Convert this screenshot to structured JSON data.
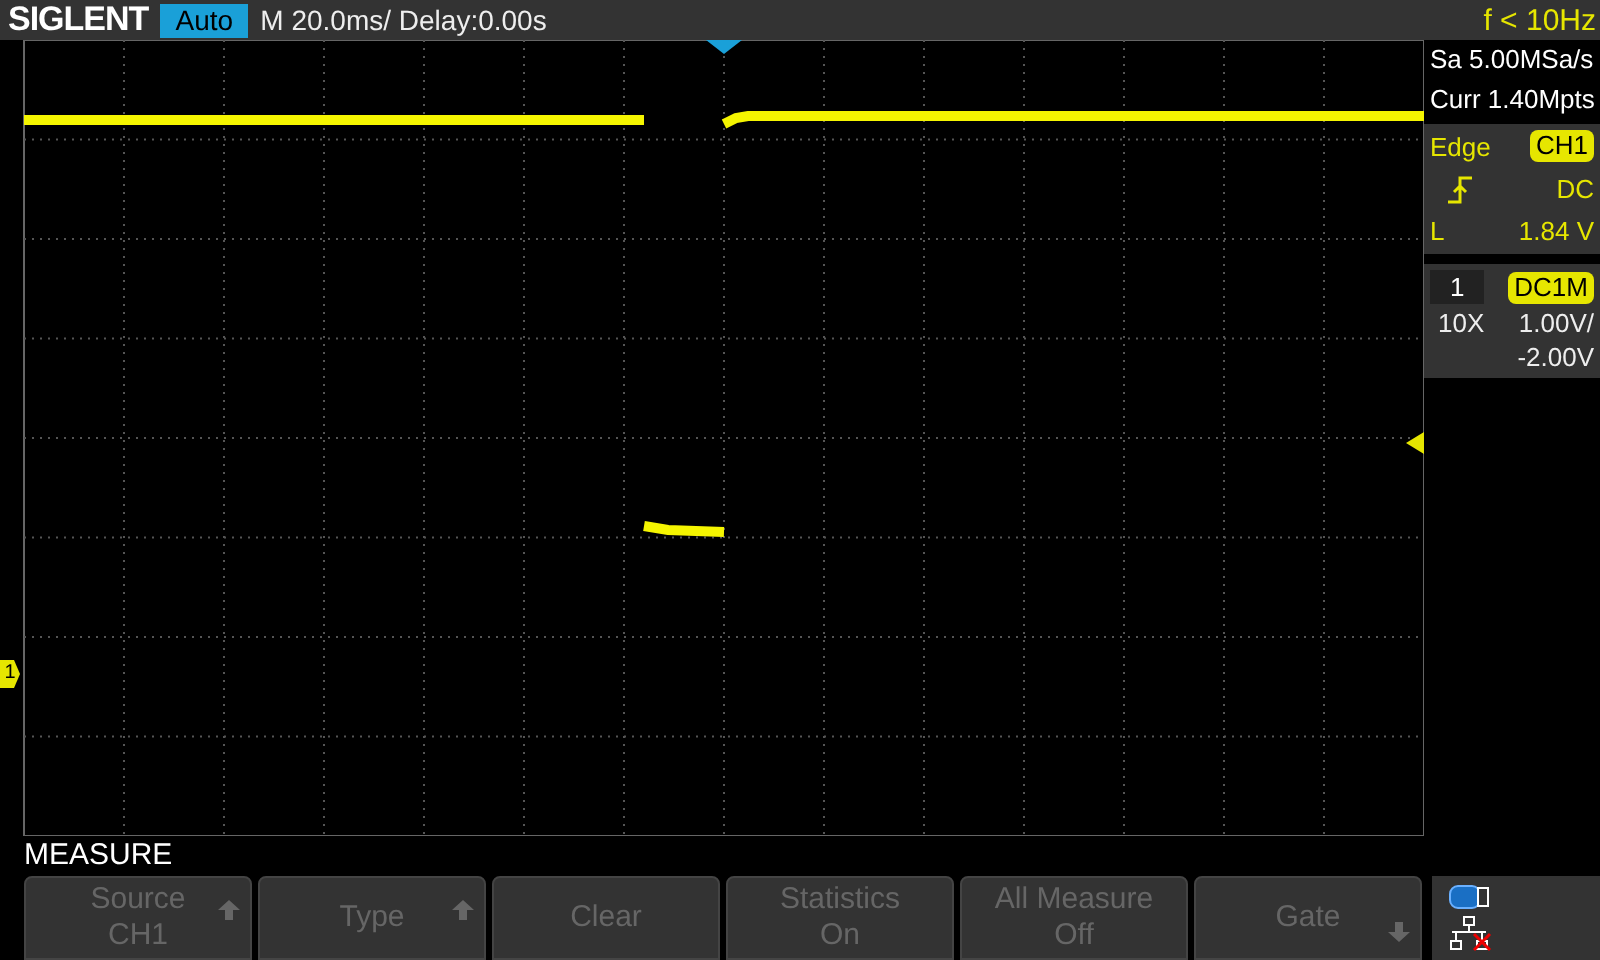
{
  "top_bar": {
    "logo": "SIGLENT",
    "run_mode": "Auto",
    "timebase": "M 20.0ms/ Delay:0.00s",
    "frequency": "f < 10Hz"
  },
  "plot": {
    "channel_marker": "1"
  },
  "info": {
    "sample_rate": "Sa 5.00MSa/s",
    "memory_depth": "Curr 1.40Mpts"
  },
  "trigger": {
    "type": "Edge",
    "source": "CH1",
    "coupling": "DC",
    "level_label": "L",
    "level": "1.84 V"
  },
  "channel": {
    "number": "1",
    "coupling": "DC1M",
    "probe": "10X",
    "scale": "1.00V/",
    "offset": "-2.00V"
  },
  "menu": {
    "title": "MEASURE",
    "softkeys": [
      {
        "label": "Source",
        "value": "CH1",
        "kind": "up"
      },
      {
        "label": "Type",
        "kind": "up"
      },
      {
        "label": "Clear",
        "kind": "plain"
      },
      {
        "label": "Statistics",
        "value": "On",
        "kind": "plain"
      },
      {
        "label": "All Measure",
        "value": "Off",
        "kind": "plain"
      },
      {
        "label": "Gate",
        "kind": "down"
      }
    ]
  }
}
